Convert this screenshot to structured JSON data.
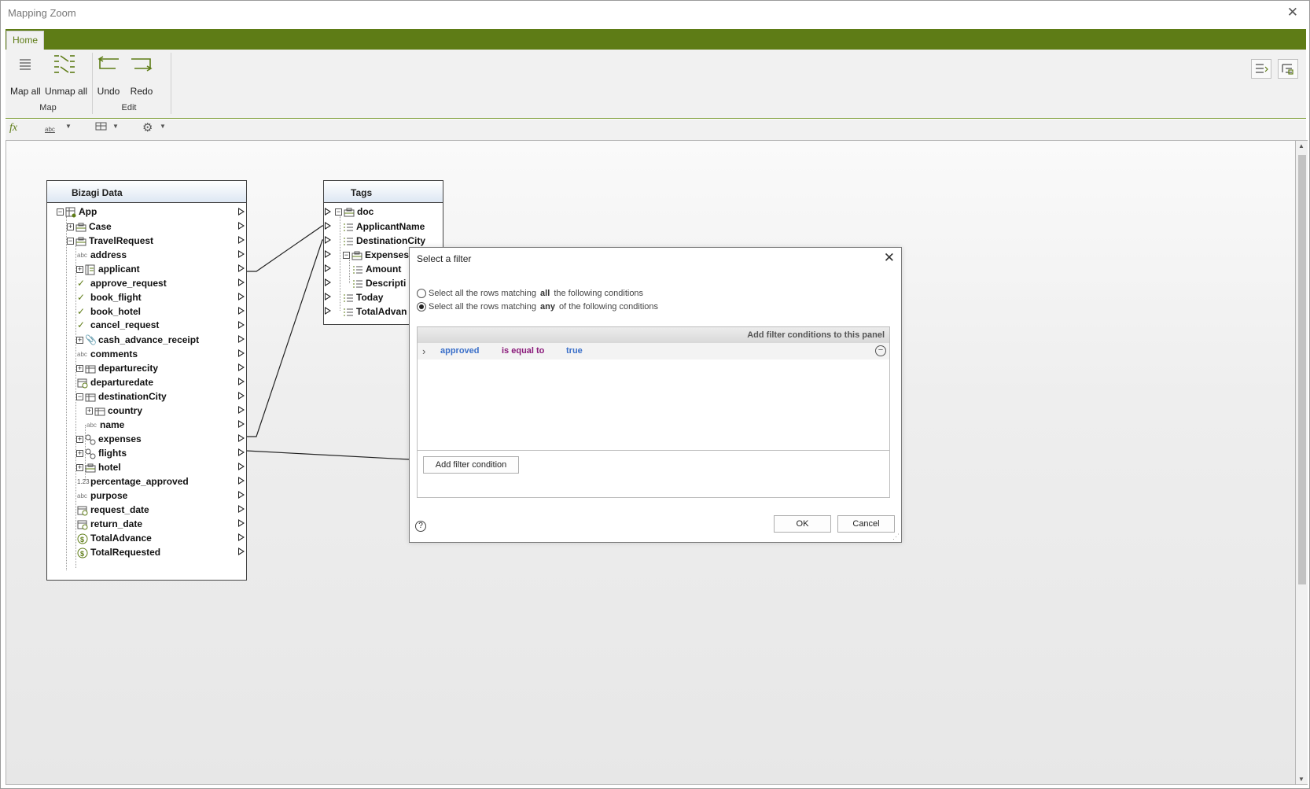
{
  "window": {
    "title": "Mapping Zoom",
    "close_glyph": "✕"
  },
  "ribbon": {
    "tab_home": "Home",
    "map_all": "Map all",
    "unmap_all": "Unmap all",
    "group_map": "Map",
    "undo": "Undo",
    "redo": "Redo",
    "group_edit": "Edit"
  },
  "toolbar2": {
    "fx": "fx",
    "abc": "abc"
  },
  "source_box": {
    "title": "Bizagi Data",
    "rows": [
      {
        "label": "App"
      },
      {
        "label": "Case"
      },
      {
        "label": "TravelRequest"
      },
      {
        "label": "address"
      },
      {
        "label": "applicant"
      },
      {
        "label": "approve_request"
      },
      {
        "label": "book_flight"
      },
      {
        "label": "book_hotel"
      },
      {
        "label": "cancel_request"
      },
      {
        "label": "cash_advance_receipt"
      },
      {
        "label": "comments"
      },
      {
        "label": "departurecity"
      },
      {
        "label": "departuredate"
      },
      {
        "label": "destinationCity"
      },
      {
        "label": "country"
      },
      {
        "label": "name"
      },
      {
        "label": "expenses"
      },
      {
        "label": "flights"
      },
      {
        "label": "hotel"
      },
      {
        "label": "percentage_approved"
      },
      {
        "label": "purpose"
      },
      {
        "label": "request_date"
      },
      {
        "label": "return_date"
      },
      {
        "label": "TotalAdvance"
      },
      {
        "label": "TotalRequested"
      }
    ]
  },
  "target_box": {
    "title": "Tags",
    "rows": [
      {
        "label": "doc"
      },
      {
        "label": "ApplicantName"
      },
      {
        "label": "DestinationCity"
      },
      {
        "label": "Expenses"
      },
      {
        "label": "Amount"
      },
      {
        "label": "Descripti"
      },
      {
        "label": "Today"
      },
      {
        "label": "TotalAdvan"
      }
    ]
  },
  "dialog": {
    "title": "Select a filter",
    "radio_all_pre": "Select all the rows matching",
    "radio_all_kw": "all",
    "radio_all_post": "the following conditions",
    "radio_any_pre": "Select all the rows matching",
    "radio_any_kw": "any",
    "radio_any_post": "of the following conditions",
    "radio_selected": "any",
    "panel_header": "Add filter conditions to this panel",
    "condition": {
      "field": "approved",
      "operator": "is equal to",
      "value": "true"
    },
    "add_condition": "Add filter condition",
    "ok": "OK",
    "cancel": "Cancel",
    "help": "?"
  },
  "colors": {
    "accent": "#5e7c16",
    "field": "#3a6fc9",
    "operator": "#8a1a7a"
  }
}
